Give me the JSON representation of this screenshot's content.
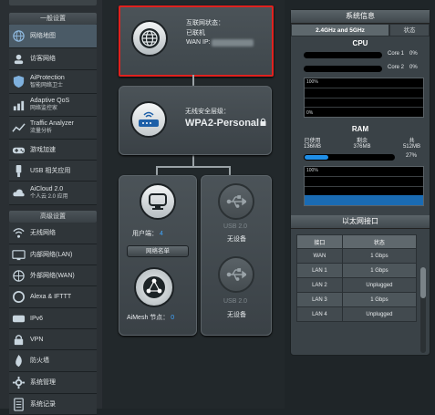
{
  "sidebar": {
    "general_title": "一般设置",
    "advanced_title": "高级设置",
    "general_items": [
      {
        "label": "网络地图",
        "sub": "",
        "icon": "network-map-icon"
      },
      {
        "label": "访客网络",
        "sub": "",
        "icon": "guest-network-icon"
      },
      {
        "label": "AiProtection",
        "sub": "智能网络卫士",
        "icon": "aiprotection-icon"
      },
      {
        "label": "Adaptive QoS",
        "sub": "网络监控家",
        "icon": "qos-icon"
      },
      {
        "label": "Traffic Analyzer",
        "sub": "流量分析",
        "icon": "traffic-analyzer-icon"
      },
      {
        "label": "游戏加速",
        "sub": "",
        "icon": "gamepad-icon"
      },
      {
        "label": "USB 相关应用",
        "sub": "",
        "icon": "usb-apps-icon"
      },
      {
        "label": "AiCloud 2.0",
        "sub": "个人云 2.0 应用",
        "icon": "cloud-icon"
      }
    ],
    "advanced_items": [
      {
        "label": "无线网络",
        "icon": "wireless-icon"
      },
      {
        "label": "内部网络(LAN)",
        "icon": "lan-icon"
      },
      {
        "label": "外部网络(WAN)",
        "icon": "wan-icon"
      },
      {
        "label": "Alexa & IFTTT",
        "icon": "alexa-icon"
      },
      {
        "label": "IPv6",
        "icon": "ipv6-icon"
      },
      {
        "label": "VPN",
        "icon": "vpn-icon"
      },
      {
        "label": "防火墙",
        "icon": "firewall-icon"
      },
      {
        "label": "系统管理",
        "icon": "admin-icon"
      },
      {
        "label": "系统记录",
        "icon": "syslog-icon"
      }
    ]
  },
  "map": {
    "internet_status_label": "互联网状态：",
    "internet_status_value": "已联机",
    "wan_ip_label": "WAN IP:",
    "wireless_security_label": "无线安全层级：",
    "wireless_security_value": "WPA2-Personal",
    "clients_label": "用户端：",
    "clients_count": "4",
    "client_list_button": "网络名单",
    "aimesh_label": "AiMesh 节点：",
    "aimesh_count": "0",
    "usb1_label": "USB 2.0",
    "usb1_status": "无设备",
    "usb2_label": "USB 2.0",
    "usb2_status": "无设备"
  },
  "status": {
    "title": "系统信息",
    "tabs": [
      "2.4GHz and 5GHz",
      "状态"
    ],
    "cpu": {
      "title": "CPU",
      "cores": [
        {
          "label": "Core 1",
          "value": "0%",
          "pct": 0.0
        },
        {
          "label": "Core 2",
          "value": "0%",
          "pct": 0.0
        }
      ],
      "graph_top": "100%",
      "graph_bottom": "0%"
    },
    "ram": {
      "title": "RAM",
      "used_label": "已使用",
      "used_value": "136MB",
      "free_label": "剩余",
      "free_value": "376MB",
      "total_label": "共",
      "total_value": "512MB",
      "percent": "27%",
      "pct": 0.27,
      "graph_top": "100%",
      "graph_bottom": "0%"
    },
    "ethernet": {
      "title": "以太网接口",
      "headers": [
        "接口",
        "状态"
      ],
      "rows": [
        [
          "WAN",
          "1 Gbps"
        ],
        [
          "LAN 1",
          "1 Gbps"
        ],
        [
          "LAN 2",
          "Unplugged"
        ],
        [
          "LAN 3",
          "1 Gbps"
        ],
        [
          "LAN 4",
          "Unplugged"
        ]
      ]
    }
  },
  "colors": {
    "highlight_border": "#e0221f",
    "accent_blue": "#1f8ee6"
  }
}
